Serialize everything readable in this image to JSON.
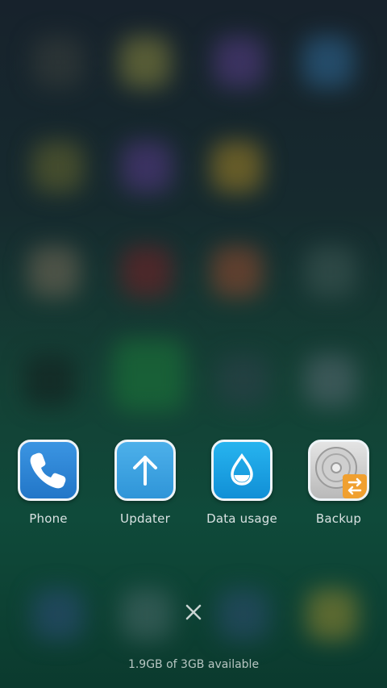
{
  "recent_apps": [
    {
      "label": "Phone",
      "icon": "phone-icon"
    },
    {
      "label": "Updater",
      "icon": "arrow-up-icon"
    },
    {
      "label": "Data usage",
      "icon": "water-drop-icon"
    },
    {
      "label": "Backup",
      "icon": "backup-icon"
    }
  ],
  "close_all_icon": "close-icon",
  "memory_status": "1.9GB of 3GB available",
  "colors": {
    "phone": "#2f86d6",
    "updater": "#3da3e3",
    "data_usage": "#1aa6e6",
    "backup_badge": "#f0a030",
    "label_text": "#d9e2e2"
  }
}
